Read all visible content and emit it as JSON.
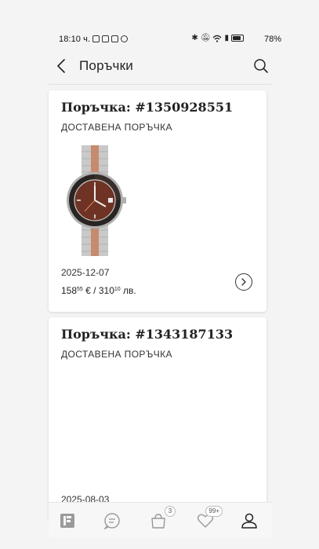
{
  "status_bar": {
    "time": "18:10 ч.",
    "battery": "78%"
  },
  "header": {
    "title": "Поръчки"
  },
  "orders": [
    {
      "number": "Поръчка: #1350928551",
      "status": "ДОСТАВЕНА ПОРЪЧКА",
      "date": "2025-12-07",
      "price_eur_main": "158",
      "price_eur_cents": "55",
      "price_eur_suffix": " € / ",
      "price_bgn_main": "310",
      "price_bgn_cents": "10",
      "price_bgn_suffix": " лв."
    },
    {
      "number": "Поръчка: #1343187133",
      "status": "ДОСТАВЕНА ПОРЪЧКА",
      "date": "2025-08-03"
    }
  ],
  "bottom_nav": {
    "items": [
      {
        "icon": "logo-icon",
        "badge": ""
      },
      {
        "icon": "chat-search-icon",
        "badge": ""
      },
      {
        "icon": "bag-icon",
        "badge": "3"
      },
      {
        "icon": "heart-icon",
        "badge": "99+"
      },
      {
        "icon": "profile-icon",
        "badge": ""
      }
    ]
  },
  "colors": {
    "background": "#f4f4f4",
    "card": "#ffffff",
    "text": "#222222"
  }
}
